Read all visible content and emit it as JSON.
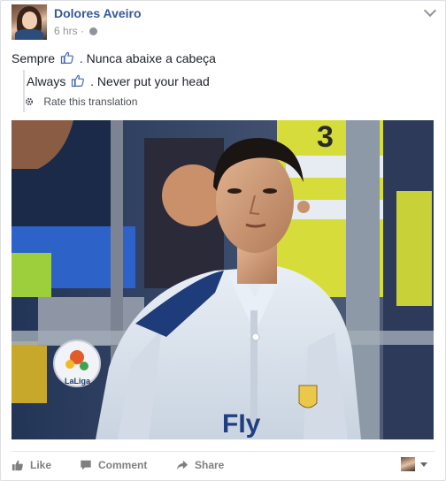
{
  "post": {
    "author": "Dolores Aveiro",
    "time": "6 hrs",
    "separator": "·",
    "text_before": "Sempre",
    "text_after": ". Nunca abaixe a cabeça",
    "translation": {
      "before": "Always",
      "after": ". Never put your head",
      "rate_label": "Rate this translation"
    },
    "photo": {
      "jersey_text": "FIy",
      "badge_text": "LaLiga"
    }
  },
  "actions": {
    "like": "Like",
    "comment": "Comment",
    "share": "Share"
  },
  "colors": {
    "link": "#365899",
    "muted": "#90949c",
    "action": "#7f7f7f",
    "jersey": "#dde6ef"
  },
  "icons": [
    "avatar",
    "globe-icon",
    "chevron-down-icon",
    "thumbs-up-icon",
    "gear-icon",
    "like-icon",
    "comment-icon",
    "share-icon"
  ]
}
